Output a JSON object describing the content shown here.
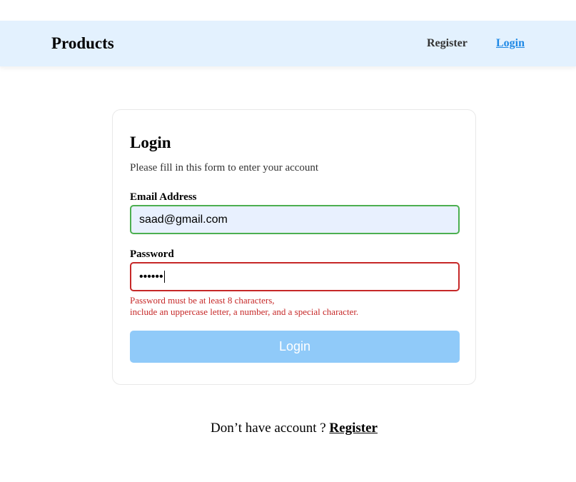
{
  "navbar": {
    "brand": "Products",
    "register_label": "Register",
    "login_label": "Login"
  },
  "form": {
    "title": "Login",
    "subtitle": "Please fill in this form to enter your account",
    "email_label": "Email Address",
    "email_value": "saad@gmail.com",
    "password_label": "Password",
    "password_masked": "••••••",
    "error_line1": "Password must be at least 8 characters,",
    "error_line2": "include an uppercase letter, a number, and a special character.",
    "submit_label": "Login"
  },
  "footer": {
    "prompt": "Don’t have account ? ",
    "register_link": "Register"
  },
  "colors": {
    "navbar_bg": "#e3f1fe",
    "accent": "#1e88e5",
    "valid_border": "#4caf50",
    "error": "#c62828",
    "button_disabled": "#90caf9"
  }
}
